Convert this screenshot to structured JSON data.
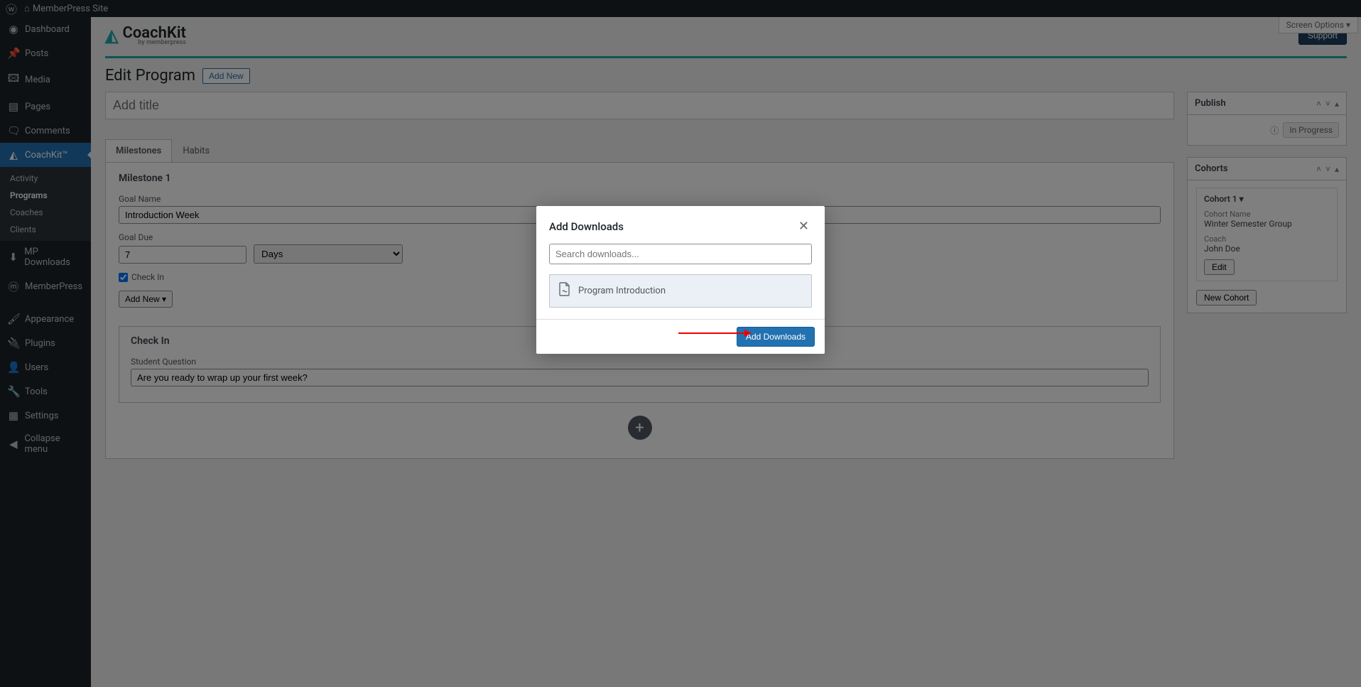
{
  "topbar": {
    "site_name": "MemberPress Site"
  },
  "menu": {
    "dashboard": "Dashboard",
    "posts": "Posts",
    "media": "Media",
    "pages": "Pages",
    "comments": "Comments",
    "coachkit": "CoachKit™",
    "sub_activity": "Activity",
    "sub_programs": "Programs",
    "sub_coaches": "Coaches",
    "sub_clients": "Clients",
    "mpdownloads": "MP Downloads",
    "memberpress": "MemberPress",
    "appearance": "Appearance",
    "plugins": "Plugins",
    "users": "Users",
    "tools": "Tools",
    "settings": "Settings",
    "collapse": "Collapse menu"
  },
  "header": {
    "logo_main": "CoachKit",
    "logo_sub": "by memberpress",
    "support": "Support",
    "screen_options": "Screen Options ▾"
  },
  "page": {
    "title": "Edit Program",
    "add_new": "Add New",
    "title_placeholder": "Add title"
  },
  "tabs": {
    "milestones": "Milestones",
    "habits": "Habits"
  },
  "milestone": {
    "heading": "Milestone 1",
    "goal_name_label": "Goal Name",
    "goal_name_value": "Introduction Week",
    "goal_due_label": "Goal Due",
    "goal_due_num": "7",
    "goal_due_unit": "Days",
    "checkin_label": "Check In",
    "add_new": "Add New ▾"
  },
  "checkin": {
    "heading": "Check In",
    "question_label": "Student Question",
    "question_value": "Are you ready to wrap up your first week?"
  },
  "publish": {
    "heading": "Publish",
    "status": "In Progress"
  },
  "cohorts": {
    "heading": "Cohorts",
    "cohort_label": "Cohort 1 ▾",
    "name_label": "Cohort Name",
    "name_value": "Winter Semester Group",
    "coach_label": "Coach",
    "coach_value": "John Doe",
    "edit": "Edit",
    "new_cohort": "New Cohort"
  },
  "modal": {
    "title": "Add Downloads",
    "search_placeholder": "Search downloads...",
    "item1": "Program Introduction",
    "submit": "Add Downloads"
  }
}
